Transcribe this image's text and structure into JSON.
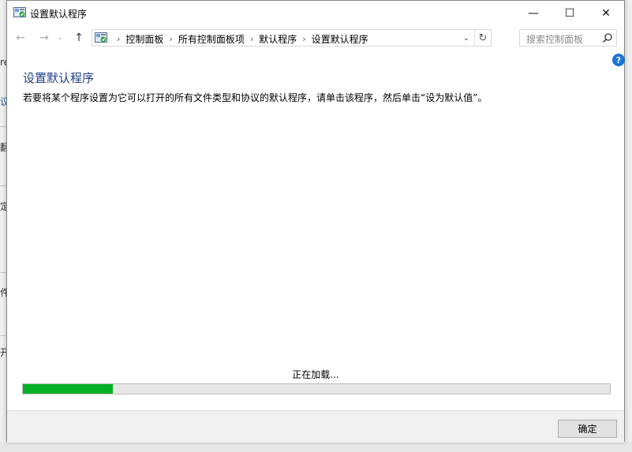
{
  "window": {
    "title": "设置默认程序",
    "controls": {
      "minimize": "—",
      "maximize": "☐",
      "close": "✕"
    }
  },
  "navigation": {
    "back": "←",
    "forward": "→",
    "recent": "⌄",
    "up": "↑",
    "breadcrumb": [
      "控制面板",
      "所有控制面板项",
      "默认程序",
      "设置默认程序"
    ],
    "separator": "›",
    "dropdown": "⌄",
    "refresh": "↻",
    "search_placeholder": "搜索控制面板"
  },
  "help_icon": "?",
  "main": {
    "title": "设置默认程序",
    "description": "若要将某个程序设置为它可以打开的所有文件类型和协议的默认程序，请单击该程序，然后单击“设为默认值”。"
  },
  "loading": {
    "text": "正在加载...",
    "progress": 0.153,
    "color": "#06b025"
  },
  "footer": {
    "ok_label": "确定"
  },
  "background_fragments": [
    "re",
    "议",
    "翻",
    "定",
    "件",
    "开",
    "—"
  ]
}
